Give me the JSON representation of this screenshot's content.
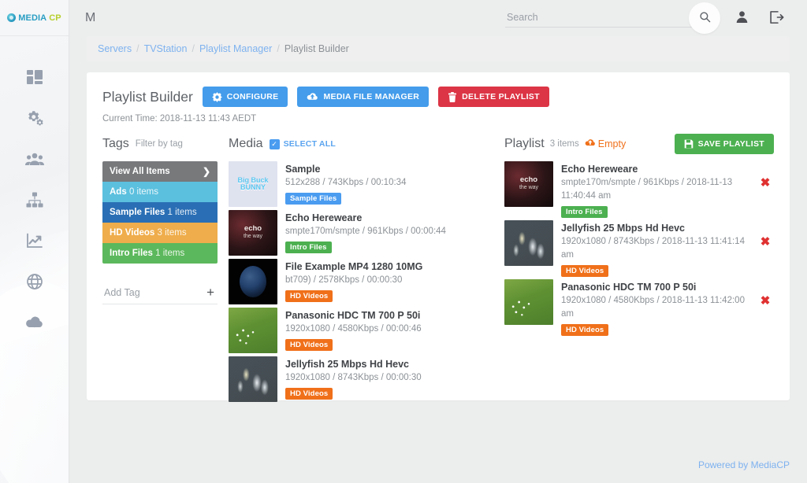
{
  "brand": {
    "name_first": "MEDIA",
    "name_last": "CP",
    "icon": "mediacp-orb-icon"
  },
  "sidebar": {
    "items": [
      {
        "icon": "dashboard-grid-icon",
        "name": "dashboard"
      },
      {
        "icon": "gears-settings-icon",
        "name": "settings"
      },
      {
        "icon": "users-group-icon",
        "name": "users"
      },
      {
        "icon": "sitemap-network-icon",
        "name": "servers"
      },
      {
        "icon": "chart-line-icon",
        "name": "statistics"
      },
      {
        "icon": "globe-icon",
        "name": "network"
      },
      {
        "icon": "cloud-download-icon",
        "name": "downloads"
      }
    ]
  },
  "topbar": {
    "title": "M",
    "search_placeholder": "Search",
    "search_value": "",
    "search_icon": "search-icon",
    "account_icon": "user-person-icon",
    "logout_icon": "logout-icon"
  },
  "breadcrumb": {
    "items": [
      {
        "label": "Servers",
        "active": false
      },
      {
        "label": "TVStation",
        "active": false
      },
      {
        "label": "Playlist Manager",
        "active": false
      },
      {
        "label": "Playlist Builder",
        "active": true
      }
    ],
    "separator": "/"
  },
  "page": {
    "title": "Playlist Builder",
    "current_time_label": "Current Time: 2018-11-13 11:43 AEDT",
    "buttons": [
      {
        "label": "CONFIGURE",
        "color": "#449ceb",
        "icon": "gear-icon"
      },
      {
        "label": "MEDIA FILE MANAGER",
        "color": "#449ceb",
        "icon": "cloud-upload-icon"
      },
      {
        "label": "DELETE PLAYLIST",
        "color": "#dc3545",
        "icon": "trash-icon"
      }
    ]
  },
  "tags_panel": {
    "title": "Tags",
    "subtitle": "Filter by tag",
    "items": [
      {
        "label": "View All Items",
        "count": "",
        "color": "#77797b",
        "chevron": "❯"
      },
      {
        "label": "Ads",
        "count": "0 items",
        "color": "#5bc0de",
        "chevron": ""
      },
      {
        "label": "Sample Files",
        "count": "1 items",
        "color": "#2a6fb5",
        "chevron": ""
      },
      {
        "label": "HD Videos",
        "count": "3 items",
        "color": "#efad4b",
        "chevron": ""
      },
      {
        "label": "Intro Files",
        "count": "1 items",
        "color": "#5cb85c",
        "chevron": ""
      }
    ],
    "add_tag_label": "Add Tag",
    "add_tag_icon": "plus-icon"
  },
  "media_panel": {
    "title": "Media",
    "select_all_label": "SELECT ALL",
    "select_all_checked": true,
    "items": [
      {
        "title": "Sample",
        "details": "512x288 / 743Kbps / 00:10:34",
        "tag": "Sample Files",
        "tag_color": "#4a9cf0",
        "thumb": "big-buck-bunny-thumbnail"
      },
      {
        "title": "Echo Hereweare",
        "details": "smpte170m/smpte / 961Kbps / 00:00:44",
        "tag": "Intro Files",
        "tag_color": "#4cb050",
        "thumb": "echo-the-way-thumbnail"
      },
      {
        "title": "File Example MP4 1280 10MG",
        "details": "bt709) / 2578Kbps / 00:00:30",
        "tag": "HD Videos",
        "tag_color": "#f0701a",
        "thumb": "earth-globe-thumbnail"
      },
      {
        "title": "Panasonic HDC TM 700 P 50i",
        "details": "1920x1080 / 4580Kbps / 00:00:46",
        "tag": "HD Videos",
        "tag_color": "#f0701a",
        "thumb": "grass-field-thumbnail"
      },
      {
        "title": "Jellyfish 25 Mbps Hd Hevc",
        "details": "1920x1080 / 8743Kbps / 00:00:30",
        "tag": "HD Videos",
        "tag_color": "#f0701a",
        "thumb": "jellyfish-thumbnail"
      }
    ]
  },
  "playlist_panel": {
    "title": "Playlist",
    "count_label": "3 items",
    "status_label": "Empty",
    "status_icon": "cloud-upload-icon",
    "status_color": "#f0701a",
    "save_button_label": "SAVE PLAYLIST",
    "save_button_icon": "floppy-save-icon",
    "save_button_color": "#4cb050",
    "remove_icon": "remove-x-icon",
    "items": [
      {
        "title": "Echo Hereweare",
        "details": "smpte170m/smpte / 961Kbps / 2018-11-13 11:40:44 am",
        "tag": "Intro Files",
        "tag_color": "#4cb050",
        "thumb": "echo-the-way-thumbnail"
      },
      {
        "title": "Jellyfish 25 Mbps Hd Hevc",
        "details": "1920x1080 / 8743Kbps / 2018-11-13 11:41:14 am",
        "tag": "HD Videos",
        "tag_color": "#f0701a",
        "thumb": "jellyfish-thumbnail"
      },
      {
        "title": "Panasonic HDC TM 700 P 50i",
        "details": "1920x1080 / 4580Kbps / 2018-11-13 11:42:00 am",
        "tag": "HD Videos",
        "tag_color": "#f0701a",
        "thumb": "grass-field-thumbnail"
      }
    ]
  },
  "footer": {
    "text": "Powered by MediaCP"
  },
  "thumbnails": {
    "big-buck-bunny-thumbnail": {
      "line1": "Big Buck",
      "line2": "BUNNY"
    },
    "echo-the-way-thumbnail": {
      "line1": "echo",
      "line2": "the way"
    }
  }
}
